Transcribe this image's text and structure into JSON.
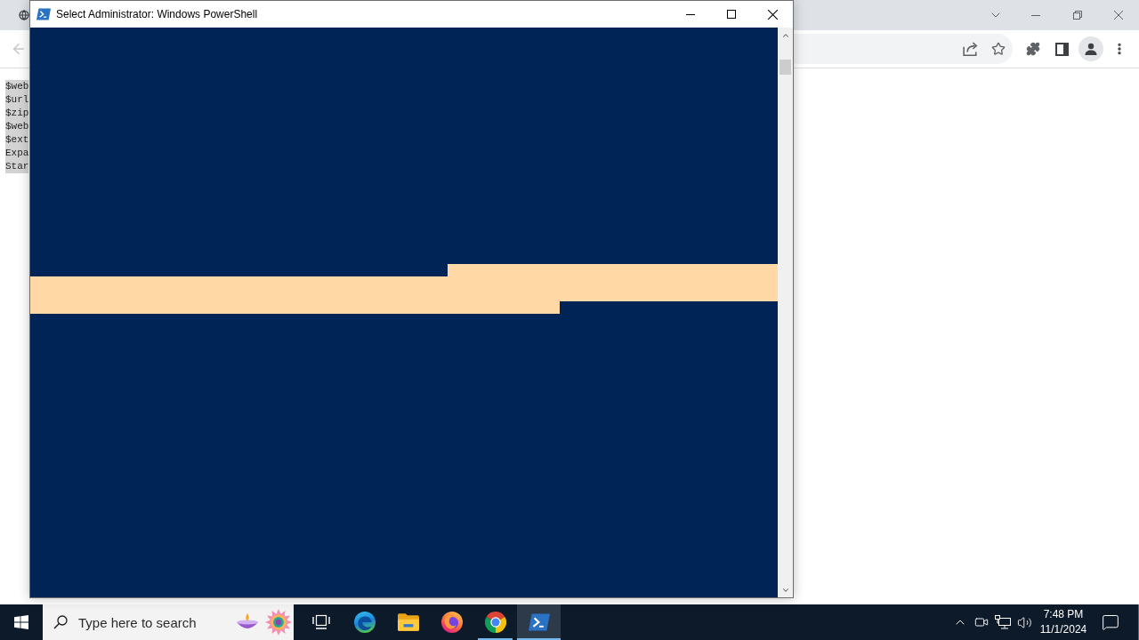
{
  "browser": {
    "toolbar": {
      "back_button": {
        "disabled": true
      }
    },
    "page": {
      "code_lines": [
        "$web",
        "$url",
        "$zip",
        "$web",
        "$ext",
        "Expa",
        "Star"
      ]
    }
  },
  "powershell_window": {
    "title": "Select Administrator: Windows PowerShell"
  },
  "taskbar": {
    "search": {
      "placeholder": "Type here to search"
    },
    "apps": [
      {
        "kind": "edge",
        "running": false,
        "selected": false
      },
      {
        "kind": "explorer",
        "running": false,
        "selected": false
      },
      {
        "kind": "firefox",
        "running": false,
        "selected": false
      },
      {
        "kind": "chrome",
        "running": true,
        "selected": false
      },
      {
        "kind": "powershell",
        "running": true,
        "selected": true
      }
    ],
    "clock": {
      "time": "7:48 PM",
      "date": "11/1/2024"
    }
  }
}
